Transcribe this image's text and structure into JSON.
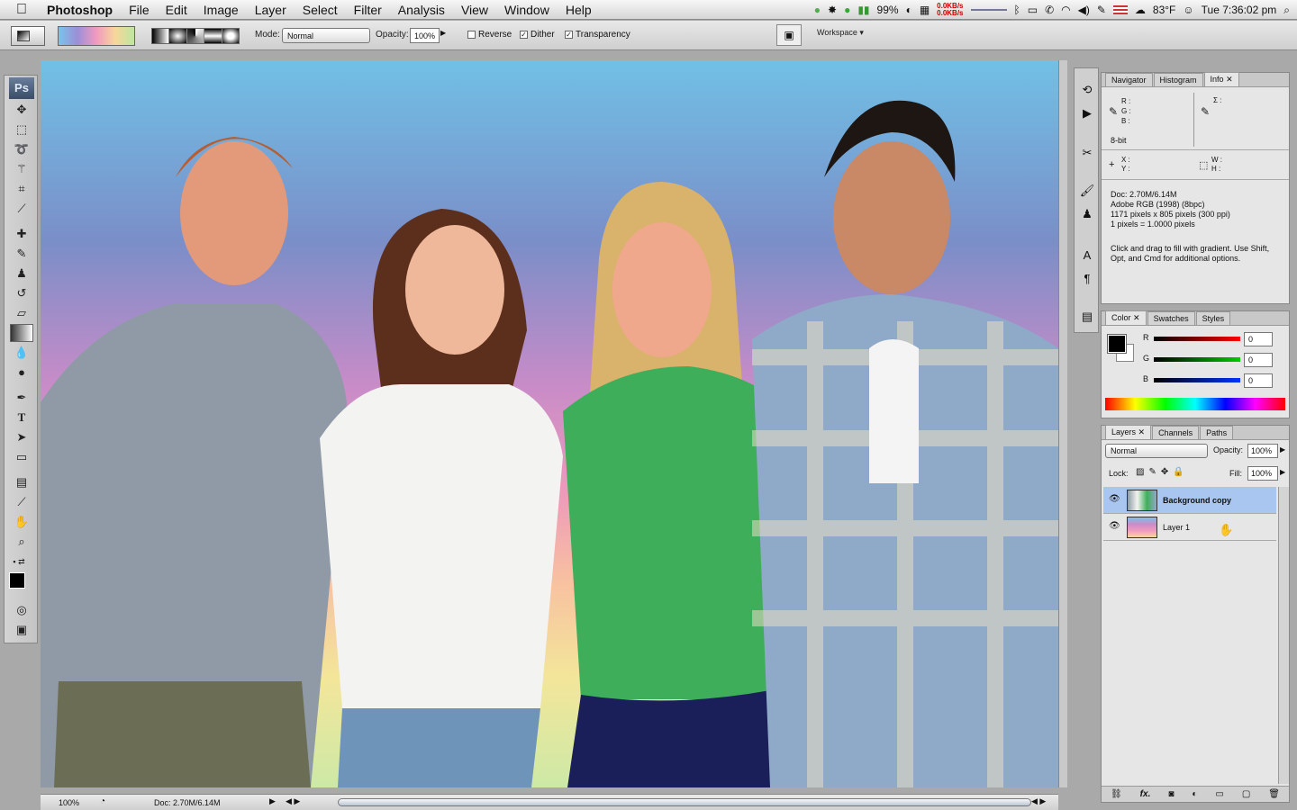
{
  "menubar": {
    "apple": "",
    "items": [
      "Photoshop",
      "File",
      "Edit",
      "Image",
      "Layer",
      "Select",
      "Filter",
      "Analysis",
      "View",
      "Window",
      "Help"
    ],
    "battery": "99%",
    "net_up": "0.0KB/s",
    "net_down": "0.0KB/s",
    "temperature": "83°F",
    "clock": "Tue 7:36:02 pm"
  },
  "options": {
    "mode_label": "Mode:",
    "mode_value": "Normal",
    "opacity_label": "Opacity:",
    "opacity_value": "100%",
    "reverse": "Reverse",
    "dither": "Dither",
    "transparency": "Transparency",
    "workspace": "Workspace"
  },
  "toolbox": {
    "logo": "Ps"
  },
  "status": {
    "zoom": "100%",
    "doc": "Doc: 2.70M/6.14M"
  },
  "info_panel": {
    "tabs": [
      "Navigator",
      "Histogram",
      "Info"
    ],
    "r": "R :",
    "g": "G :",
    "b": "B :",
    "sigma": "Σ :",
    "bit": "8-bit",
    "x": "X :",
    "y": "Y :",
    "w": "W :",
    "h": "H :",
    "doc_lines": [
      "Doc: 2.70M/6.14M",
      "Adobe RGB (1998) (8bpc)",
      "1171 pixels x 805 pixels (300 ppi)",
      "1 pixels = 1.0000 pixels"
    ],
    "hint": "Click and drag to fill with gradient.  Use Shift, Opt, and Cmd for additional options."
  },
  "color_panel": {
    "tabs": [
      "Color",
      "Swatches",
      "Styles"
    ],
    "r_label": "R",
    "g_label": "G",
    "b_label": "B",
    "r_value": "0",
    "g_value": "0",
    "b_value": "0"
  },
  "layers_panel": {
    "tabs": [
      "Layers",
      "Channels",
      "Paths"
    ],
    "blend": "Normal",
    "opacity_label": "Opacity:",
    "opacity_value": "100%",
    "lock_label": "Lock:",
    "fill_label": "Fill:",
    "fill_value": "100%",
    "layers": [
      {
        "name": "Background copy",
        "selected": true
      },
      {
        "name": "Layer 1",
        "selected": false
      }
    ],
    "fx": "fx."
  },
  "colors": {
    "selection": "#a9c6f0",
    "canvas_bg": "#a9a9a9"
  }
}
